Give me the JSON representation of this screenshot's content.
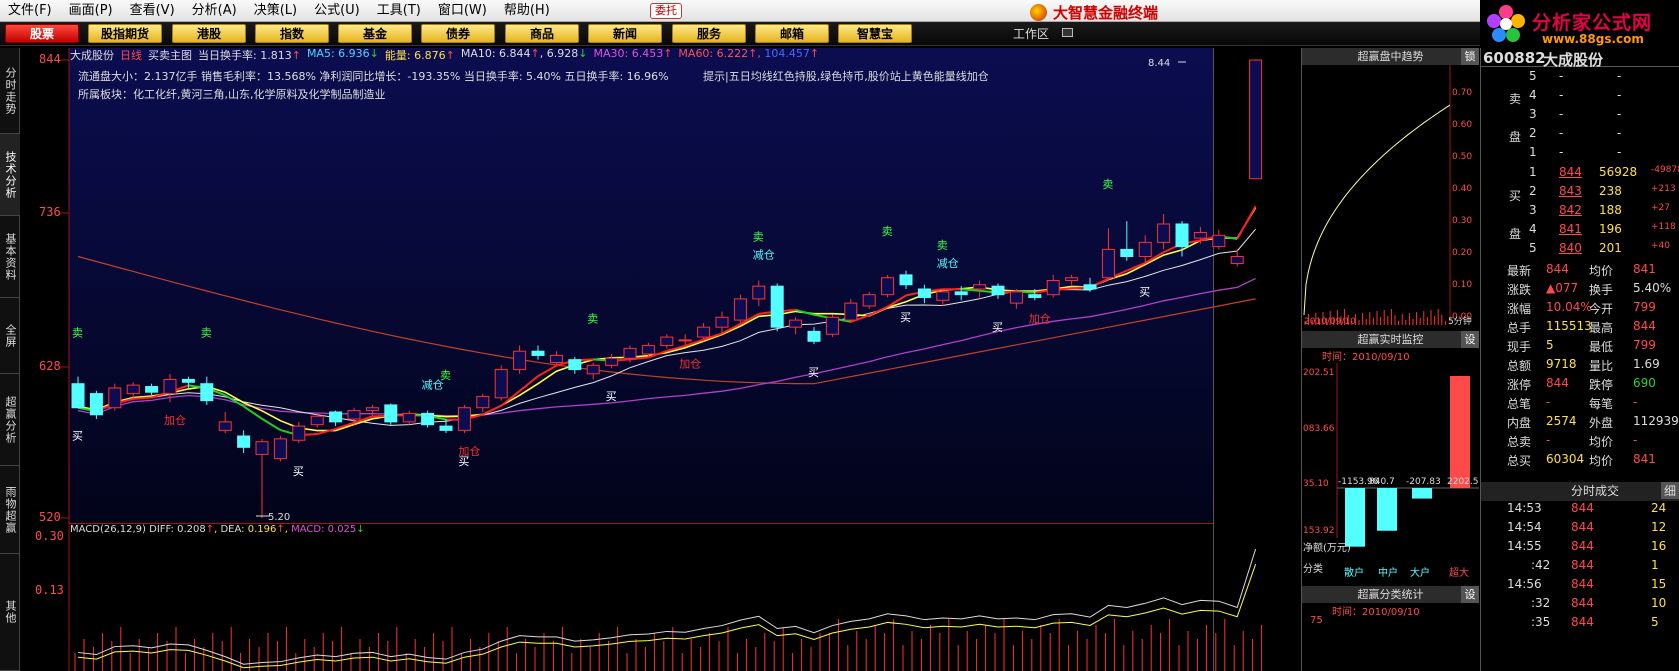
{
  "menu": [
    "文件(F)",
    "画面(P)",
    "查看(V)",
    "分析(A)",
    "决策(L)",
    "公式(U)",
    "工具(T)",
    "窗口(W)",
    "帮助(H)"
  ],
  "entrust": "委托",
  "brand": "大智慧金融终端",
  "site": {
    "title": "分析家公式网",
    "url": "www.88gs.com"
  },
  "toolbar": [
    "股票",
    "股指期货",
    "港股",
    "指数",
    "基金",
    "债券",
    "商品",
    "新闻",
    "服务",
    "邮箱",
    "智慧宝"
  ],
  "workspace": "工作区",
  "lefttabs": [
    "分时走势",
    "技术分析",
    "基本资料",
    "全屏",
    "超赢分析",
    "雨物超赢",
    "其他"
  ],
  "chart_header": {
    "stock": "大成股份",
    "period": "日线",
    "formula": "买卖主图",
    "turnover_label": "当日换手率:",
    "turnover": "1.813",
    "ma5_label": "MA5:",
    "ma5": "6.936",
    "vol_label": "能量:",
    "vol": "6.876",
    "ma10_label": "MA10:",
    "ma10": "6.844",
    "ma10b": "6.928",
    "ma30_label": "MA30:",
    "ma30": "6.453",
    "ma60_label": "MA60:",
    "ma60": "6.222",
    "ma120": "104.457"
  },
  "fund_line": "流通盘大小：2.137亿手   销售毛利率：13.568%   净利润同比增长：-193.35% 当日换手率: 5.40%  五日换手率:  16.96%",
  "sector_line": "所属板块：化工化纤,黄河三角,山东,化学原料及化学制品制造业",
  "tip": "提示|五日均线红色持股,绿色持币,股价站上黄色能量线加仓",
  "y_labels": [
    "844",
    "736",
    "628",
    "520"
  ],
  "macd_y": [
    "0.30",
    "0.13"
  ],
  "macd_header": {
    "name": "MACD(26,12,9)",
    "diff_label": "DIFF:",
    "diff": "0.208",
    "dea_label": "DEA:",
    "dea": "0.196",
    "macd_label": "MACD:",
    "macd": "0.025"
  },
  "high_label": "8.44",
  "low_label": "5.20",
  "chart_data": {
    "type": "candlestick",
    "ylim": [
      5.2,
      8.44
    ],
    "candles": [
      {
        "o": 6.15,
        "c": 5.98,
        "h": 6.2,
        "l": 5.98,
        "note": ""
      },
      {
        "o": 6.08,
        "c": 5.93,
        "h": 6.1,
        "l": 5.9
      },
      {
        "o": 5.98,
        "c": 6.12,
        "h": 6.15,
        "l": 5.96
      },
      {
        "o": 6.08,
        "c": 6.14,
        "h": 6.16,
        "l": 6.05
      },
      {
        "o": 6.13,
        "c": 6.09,
        "h": 6.15,
        "l": 6.07
      },
      {
        "o": 6.08,
        "c": 6.18,
        "h": 6.22,
        "l": 6.02
      },
      {
        "o": 6.18,
        "c": 6.16,
        "h": 6.2,
        "l": 6.12
      },
      {
        "o": 6.15,
        "c": 6.03,
        "h": 6.2,
        "l": 6.0
      },
      {
        "o": 5.82,
        "c": 5.88,
        "h": 5.95,
        "l": 5.8
      },
      {
        "o": 5.78,
        "c": 5.7,
        "h": 5.82,
        "l": 5.66
      },
      {
        "o": 5.65,
        "c": 5.74,
        "h": 5.76,
        "l": 5.2
      },
      {
        "o": 5.62,
        "c": 5.76,
        "h": 5.78,
        "l": 5.6
      },
      {
        "o": 5.75,
        "c": 5.85,
        "h": 5.88,
        "l": 5.73
      },
      {
        "o": 5.86,
        "c": 5.92,
        "h": 5.94,
        "l": 5.84
      },
      {
        "o": 5.95,
        "c": 5.88,
        "h": 5.96,
        "l": 5.85
      },
      {
        "o": 5.9,
        "c": 5.96,
        "h": 5.98,
        "l": 5.86
      },
      {
        "o": 5.96,
        "c": 5.98,
        "h": 6.0,
        "l": 5.92
      },
      {
        "o": 6.0,
        "c": 5.88,
        "h": 6.01,
        "l": 5.86
      },
      {
        "o": 5.88,
        "c": 5.94,
        "h": 5.96,
        "l": 5.86
      },
      {
        "o": 5.94,
        "c": 5.86,
        "h": 5.96,
        "l": 5.84
      },
      {
        "o": 5.85,
        "c": 5.82,
        "h": 5.9,
        "l": 5.8
      },
      {
        "o": 5.82,
        "c": 5.98,
        "h": 6.0,
        "l": 5.8
      },
      {
        "o": 5.98,
        "c": 6.06,
        "h": 6.08,
        "l": 5.95
      },
      {
        "o": 6.05,
        "c": 6.25,
        "h": 6.28,
        "l": 6.03
      },
      {
        "o": 6.25,
        "c": 6.38,
        "h": 6.42,
        "l": 6.22
      },
      {
        "o": 6.38,
        "c": 6.35,
        "h": 6.42,
        "l": 6.32
      },
      {
        "o": 6.3,
        "c": 6.35,
        "h": 6.38,
        "l": 6.28
      },
      {
        "o": 6.32,
        "c": 6.25,
        "h": 6.34,
        "l": 6.22
      },
      {
        "o": 6.22,
        "c": 6.28,
        "h": 6.3,
        "l": 6.18
      },
      {
        "o": 6.28,
        "c": 6.33,
        "h": 6.36,
        "l": 6.26
      },
      {
        "o": 6.33,
        "c": 6.4,
        "h": 6.42,
        "l": 6.3
      },
      {
        "o": 6.36,
        "c": 6.42,
        "h": 6.44,
        "l": 6.34
      },
      {
        "o": 6.42,
        "c": 6.48,
        "h": 6.5,
        "l": 6.4
      },
      {
        "o": 6.46,
        "c": 6.46,
        "h": 6.5,
        "l": 6.42
      },
      {
        "o": 6.48,
        "c": 6.55,
        "h": 6.58,
        "l": 6.45
      },
      {
        "o": 6.55,
        "c": 6.62,
        "h": 6.66,
        "l": 6.5
      },
      {
        "o": 6.6,
        "c": 6.75,
        "h": 6.78,
        "l": 6.58
      },
      {
        "o": 6.75,
        "c": 6.84,
        "h": 6.88,
        "l": 6.7
      },
      {
        "o": 6.84,
        "c": 6.55,
        "h": 6.86,
        "l": 6.52
      },
      {
        "o": 6.55,
        "c": 6.6,
        "h": 6.62,
        "l": 6.5
      },
      {
        "o": 6.52,
        "c": 6.45,
        "h": 6.55,
        "l": 6.43
      },
      {
        "o": 6.5,
        "c": 6.62,
        "h": 6.64,
        "l": 6.48
      },
      {
        "o": 6.6,
        "c": 6.72,
        "h": 6.75,
        "l": 6.58
      },
      {
        "o": 6.7,
        "c": 6.78,
        "h": 6.8,
        "l": 6.68
      },
      {
        "o": 6.78,
        "c": 6.9,
        "h": 6.92,
        "l": 6.76
      },
      {
        "o": 6.92,
        "c": 6.85,
        "h": 6.95,
        "l": 6.82
      },
      {
        "o": 6.82,
        "c": 6.76,
        "h": 6.85,
        "l": 6.72
      },
      {
        "o": 6.74,
        "c": 6.8,
        "h": 6.82,
        "l": 6.7
      },
      {
        "o": 6.8,
        "c": 6.78,
        "h": 6.84,
        "l": 6.74
      },
      {
        "o": 6.82,
        "c": 6.85,
        "h": 6.88,
        "l": 6.76
      },
      {
        "o": 6.84,
        "c": 6.78,
        "h": 6.86,
        "l": 6.75
      },
      {
        "o": 6.72,
        "c": 6.8,
        "h": 6.82,
        "l": 6.68
      },
      {
        "o": 6.78,
        "c": 6.76,
        "h": 6.82,
        "l": 6.74
      },
      {
        "o": 6.78,
        "c": 6.88,
        "h": 6.92,
        "l": 6.76
      },
      {
        "o": 6.88,
        "c": 6.9,
        "h": 6.92,
        "l": 6.85
      },
      {
        "o": 6.85,
        "c": 6.82,
        "h": 6.9,
        "l": 6.8
      },
      {
        "o": 6.9,
        "c": 7.1,
        "h": 7.25,
        "l": 6.88
      },
      {
        "o": 7.1,
        "c": 7.05,
        "h": 7.3,
        "l": 7.02
      },
      {
        "o": 7.05,
        "c": 7.15,
        "h": 7.2,
        "l": 7.0
      },
      {
        "o": 7.15,
        "c": 7.28,
        "h": 7.35,
        "l": 7.1
      },
      {
        "o": 7.28,
        "c": 7.12,
        "h": 7.3,
        "l": 7.05
      },
      {
        "o": 7.18,
        "c": 7.22,
        "h": 7.26,
        "l": 7.14
      },
      {
        "o": 7.12,
        "c": 7.2,
        "h": 7.24,
        "l": 7.1
      },
      {
        "o": 7.0,
        "c": 7.05,
        "h": 7.1,
        "l": 6.98
      },
      {
        "o": 7.6,
        "c": 8.44,
        "h": 8.44,
        "l": 7.6
      }
    ]
  },
  "panels": {
    "trend": "超赢盘中趋势",
    "trend_btn": "锁",
    "trend_date": "2010/09/10",
    "trend_period": "5分钟",
    "trend_axis": [
      "0.70",
      "0.60",
      "0.50",
      "0.40",
      "0.30",
      "0.20",
      "0.10",
      "0.00"
    ],
    "monitor": "超赢实时监控",
    "monitor_btn": "设",
    "monitor_time": "时间：2010/09/10",
    "monitor_axis": [
      "202.51",
      "083.66",
      "35.10",
      "153.92"
    ],
    "bar_values": [
      "-1153.96",
      "840.7",
      "-207.83",
      "2202.51"
    ],
    "bar_cats": [
      "散户",
      "中户",
      "大户",
      "超大"
    ],
    "net_label": "净额(万元)",
    "cat_label": "分类",
    "stats": "超赢分类统计",
    "stats_btn": "设",
    "stats_time": "时间：2010/09/10",
    "stats_axis": "75"
  },
  "quote": {
    "code": "600882",
    "name": "大成股份",
    "sell": [
      {
        "n": "5",
        "p": "-",
        "v": "-"
      },
      {
        "n": "4",
        "p": "-",
        "v": "-"
      },
      {
        "n": "3",
        "p": "-",
        "v": "-"
      },
      {
        "n": "2",
        "p": "-",
        "v": "-"
      },
      {
        "n": "1",
        "p": "-",
        "v": "-"
      }
    ],
    "sell_label": "卖盘",
    "buy_label": "买盘",
    "buy": [
      {
        "n": "1",
        "p": "844",
        "v": "56928",
        "d": "-49878"
      },
      {
        "n": "2",
        "p": "843",
        "v": "238",
        "d": "+213"
      },
      {
        "n": "3",
        "p": "842",
        "v": "188",
        "d": "+27"
      },
      {
        "n": "4",
        "p": "841",
        "v": "196",
        "d": "+118"
      },
      {
        "n": "5",
        "p": "840",
        "v": "201",
        "d": "+40"
      }
    ],
    "stats": [
      {
        "l1": "最新",
        "v1": "844",
        "l2": "均价",
        "v2": "841"
      },
      {
        "l1": "涨跌",
        "v1": "▲077",
        "l2": "换手",
        "v2": "5.40%"
      },
      {
        "l1": "涨幅",
        "v1": "10.04%",
        "l2": "今开",
        "v2": "799"
      },
      {
        "l1": "总手",
        "v1": "115513",
        "l2": "最高",
        "v2": "844"
      },
      {
        "l1": "现手",
        "v1": "5",
        "l2": "最低",
        "v2": "799"
      },
      {
        "l1": "总额",
        "v1": "9718",
        "l2": "量比",
        "v2": "1.69"
      },
      {
        "l1": "涨停",
        "v1": "844",
        "l2": "跌停",
        "v2": "690"
      },
      {
        "l1": "总笔",
        "v1": "-",
        "l2": "每笔",
        "v2": "-"
      },
      {
        "l1": "内盘",
        "v1": "2574",
        "l2": "外盘",
        "v2": "112939"
      },
      {
        "l1": "总卖",
        "v1": "-",
        "l2": "均价",
        "v2": "-"
      },
      {
        "l1": "总买",
        "v1": "60304",
        "l2": "均价",
        "v2": "841"
      }
    ],
    "ticks_title": "分时成交",
    "ticks_btn": "细",
    "ticks": [
      {
        "t": "14:53",
        "p": "844",
        "v": "24"
      },
      {
        "t": "14:54",
        "p": "844",
        "v": "12"
      },
      {
        "t": "14:55",
        "p": "844",
        "v": "16"
      },
      {
        "t": ":42",
        "p": "844",
        "v": "1"
      },
      {
        "t": "14:56",
        "p": "844",
        "v": "15"
      },
      {
        "t": ":32",
        "p": "844",
        "v": "10"
      },
      {
        "t": ":35",
        "p": "844",
        "v": "5"
      }
    ]
  },
  "signals": [
    {
      "i": 0,
      "t": "卖",
      "k": "sell"
    },
    {
      "i": 0,
      "t": "买",
      "k": "buy"
    },
    {
      "i": 7,
      "t": "卖",
      "k": "sell"
    },
    {
      "i": 5,
      "t": "加仓",
      "k": "add"
    },
    {
      "i": 12,
      "t": "买",
      "k": "buy"
    },
    {
      "i": 19,
      "t": "减仓",
      "k": "cut"
    },
    {
      "i": 20,
      "t": "卖",
      "k": "sell"
    },
    {
      "i": 21,
      "t": "加仓",
      "k": "add"
    },
    {
      "i": 21,
      "t": "买",
      "k": "buy"
    },
    {
      "i": 28,
      "t": "卖",
      "k": "sell"
    },
    {
      "i": 29,
      "t": "买",
      "k": "buy"
    },
    {
      "i": 33,
      "t": "加仓",
      "k": "add"
    },
    {
      "i": 37,
      "t": "卖",
      "k": "sell"
    },
    {
      "i": 37,
      "t": "减仓",
      "k": "cut"
    },
    {
      "i": 40,
      "t": "买",
      "k": "buy"
    },
    {
      "i": 44,
      "t": "卖",
      "k": "sell"
    },
    {
      "i": 45,
      "t": "买",
      "k": "buy"
    },
    {
      "i": 47,
      "t": "卖",
      "k": "sell"
    },
    {
      "i": 47,
      "t": "减仓",
      "k": "cut"
    },
    {
      "i": 50,
      "t": "买",
      "k": "buy"
    },
    {
      "i": 52,
      "t": "加仓",
      "k": "add"
    },
    {
      "i": 56,
      "t": "卖",
      "k": "sell"
    },
    {
      "i": 58,
      "t": "买",
      "k": "buy"
    }
  ]
}
